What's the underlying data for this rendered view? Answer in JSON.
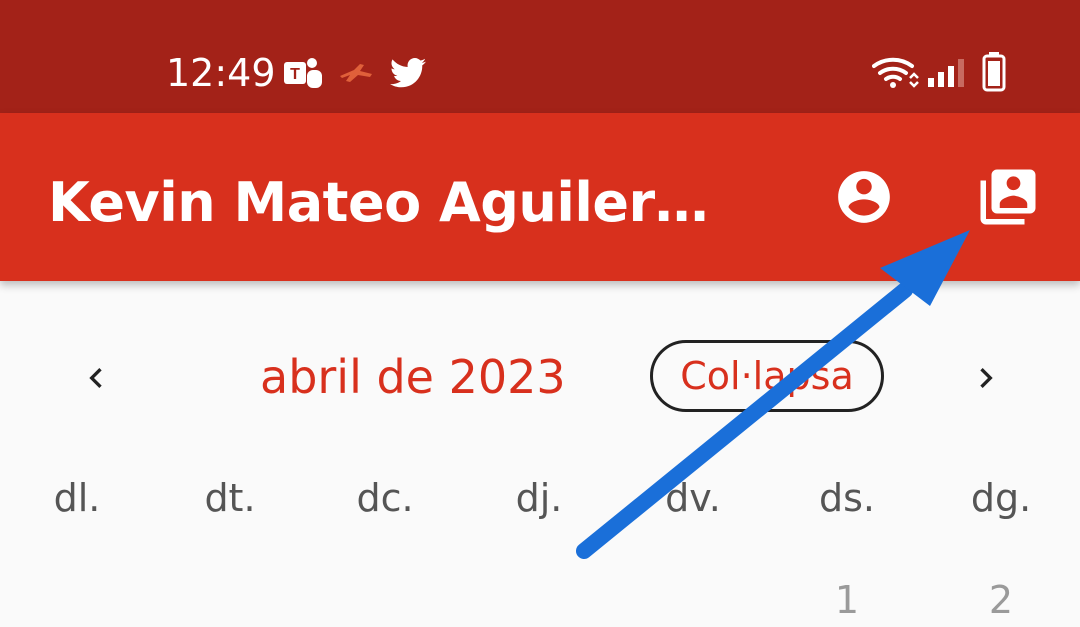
{
  "status_bar": {
    "time": "12:49",
    "notification_icons": [
      "teams-icon",
      "flight-icon",
      "twitter-icon"
    ],
    "system_icons": [
      "wifi-icon",
      "signal-icon",
      "battery-icon"
    ],
    "background_color": "#a32218"
  },
  "app_bar": {
    "title": "Kevin Mateo Aguilera G...",
    "background_color": "#d8301d",
    "actions": [
      {
        "name": "account-circle-icon"
      },
      {
        "name": "switch-profile-icon"
      }
    ]
  },
  "calendar": {
    "month_label": "abril de 2023",
    "collapse_label": "Col·lapsa",
    "prev_icon": "chevron-left-icon",
    "next_icon": "chevron-right-icon",
    "weekdays": [
      "dl.",
      "dt.",
      "dc.",
      "dj.",
      "dv.",
      "ds.",
      "dg."
    ],
    "first_row_days": [
      "1",
      "2"
    ],
    "accent_color": "#d8301d"
  },
  "annotation": {
    "arrow_color": "#1a6fd9"
  }
}
